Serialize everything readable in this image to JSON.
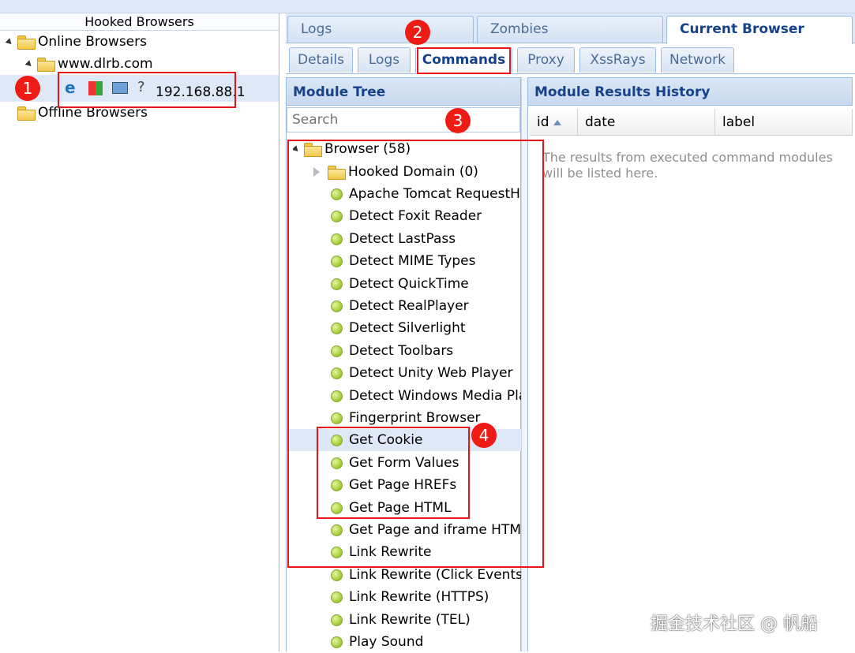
{
  "left_panel": {
    "header": "Hooked Browsers",
    "online": "Online Browsers",
    "domain": "www.dlrb.com",
    "host_ip": "192.168.88.1",
    "offline": "Offline Browsers",
    "host_icons": [
      "edge-browser-icon",
      "windows-os-icon",
      "desktop-hardware-icon",
      "unknown-icon"
    ]
  },
  "top_tabs": [
    "Logs",
    "Zombies",
    "Current Browser"
  ],
  "sub_tabs": [
    "Details",
    "Logs",
    "Commands",
    "Proxy",
    "XssRays",
    "Network"
  ],
  "module_tree": {
    "title": "Module Tree",
    "search_placeholder": "Search",
    "root": "Browser (58)",
    "hooked_domain": "Hooked Domain (0)",
    "items": [
      "Apache Tomcat RequestHeaderDump",
      "Detect Foxit Reader",
      "Detect LastPass",
      "Detect MIME Types",
      "Detect QuickTime",
      "Detect RealPlayer",
      "Detect Silverlight",
      "Detect Toolbars",
      "Detect Unity Web Player",
      "Detect Windows Media Player",
      "Fingerprint Browser",
      "Get Cookie",
      "Get Form Values",
      "Get Page HREFs",
      "Get Page HTML",
      "Get Page and iframe HTML",
      "Link Rewrite",
      "Link Rewrite (Click Events)",
      "Link Rewrite (HTTPS)",
      "Link Rewrite (TEL)",
      "Play Sound"
    ]
  },
  "results": {
    "title": "Module Results History",
    "columns": [
      "id",
      "date",
      "label"
    ],
    "empty_message": "The results from executed command modules will be listed here."
  },
  "annotations": [
    "1",
    "2",
    "3",
    "4"
  ],
  "watermark": "掘金技术社区 @ 帆船",
  "colors": {
    "accent": "#15428b",
    "highlight": "#dfe8f6",
    "annotation_red": "#e8141a"
  }
}
